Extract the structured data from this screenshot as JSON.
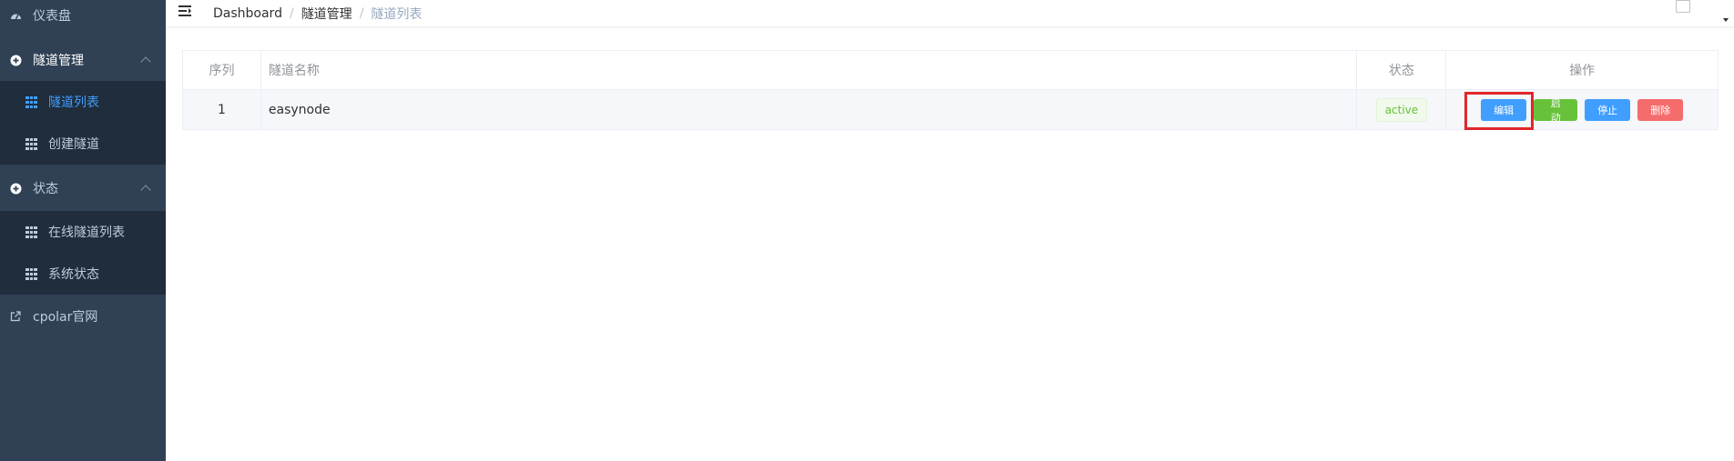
{
  "sidebar": {
    "dashboard": {
      "label": "仪表盘",
      "icon": "dashboard-icon"
    },
    "tunnel_mgmt": {
      "label": "隧道管理",
      "icon": "plus-circle-icon"
    },
    "tunnel_list": {
      "label": "隧道列表",
      "icon": "grid-icon"
    },
    "create_tunnel": {
      "label": "创建隧道",
      "icon": "grid-icon"
    },
    "status": {
      "label": "状态",
      "icon": "plus-circle-icon"
    },
    "online_tunnels": {
      "label": "在线隧道列表",
      "icon": "grid-icon"
    },
    "system_status": {
      "label": "系统状态",
      "icon": "grid-icon"
    },
    "cpolar_site": {
      "label": "cpolar官网",
      "icon": "external-link-icon"
    }
  },
  "breadcrumb": {
    "home": "Dashboard",
    "section": "隧道管理",
    "current": "隧道列表",
    "separator": "/"
  },
  "table": {
    "headers": [
      "序列",
      "隧道名称",
      "状态",
      "操作"
    ],
    "rows": [
      {
        "index": "1",
        "name": "easynode",
        "status": "active"
      }
    ],
    "actions": {
      "edit": "编辑",
      "start": "启动",
      "stop": "停止",
      "delete": "删除"
    }
  },
  "colors": {
    "sidebar_bg": "#304156",
    "submenu_bg": "#1f2d3d",
    "accent": "#409eff",
    "success": "#67c23a",
    "danger": "#f56c6c",
    "highlight": "#e0262b"
  }
}
